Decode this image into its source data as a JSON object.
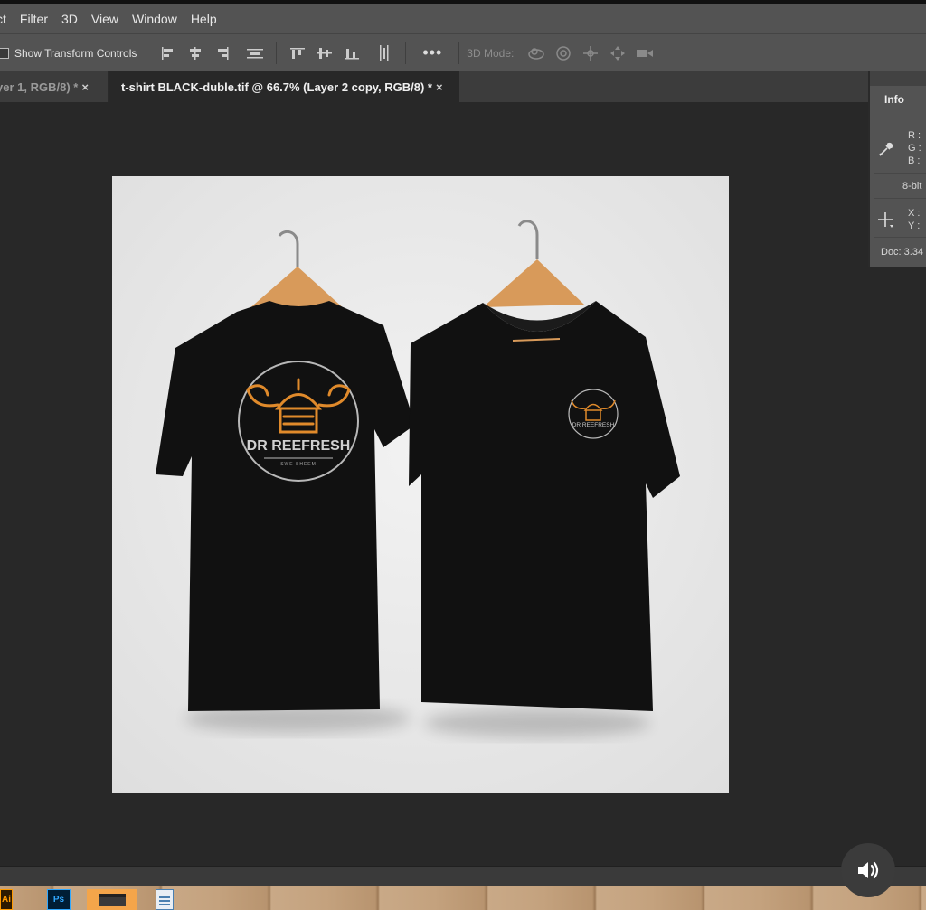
{
  "menu": {
    "items": [
      "ct",
      "Filter",
      "3D",
      "View",
      "Window",
      "Help"
    ]
  },
  "options_bar": {
    "show_transform_label": "Show Transform Controls",
    "show_transform_checked": false,
    "more_label": "•••",
    "mode_label": "3D Mode:"
  },
  "tabs": {
    "inactive": {
      "label": "yer 1, RGB/8) *",
      "close": "×"
    },
    "active": {
      "label": "t-shirt BLACK-duble.tif @ 66.7% (Layer 2 copy, RGB/8) *",
      "close": "×"
    }
  },
  "info_panel": {
    "tab_label": "Info",
    "r": "R :",
    "g": "G :",
    "b": "B :",
    "bit_depth": "8-bit",
    "x": "X :",
    "y": "Y :",
    "doc": "Doc: 3.34"
  },
  "artwork": {
    "brand_name": "DR REEFRESH",
    "tagline": "SWE SHEEM",
    "accent_color": "#e08a2b",
    "shirt_color": "#111111",
    "backdrop_color": "#ececec"
  },
  "taskbar": {
    "ai_label": "Ai",
    "ps_label": "Ps"
  },
  "colors": {
    "chrome": "#535353",
    "workspace": "#282828",
    "tab_inactive": "#3c3c3c"
  }
}
